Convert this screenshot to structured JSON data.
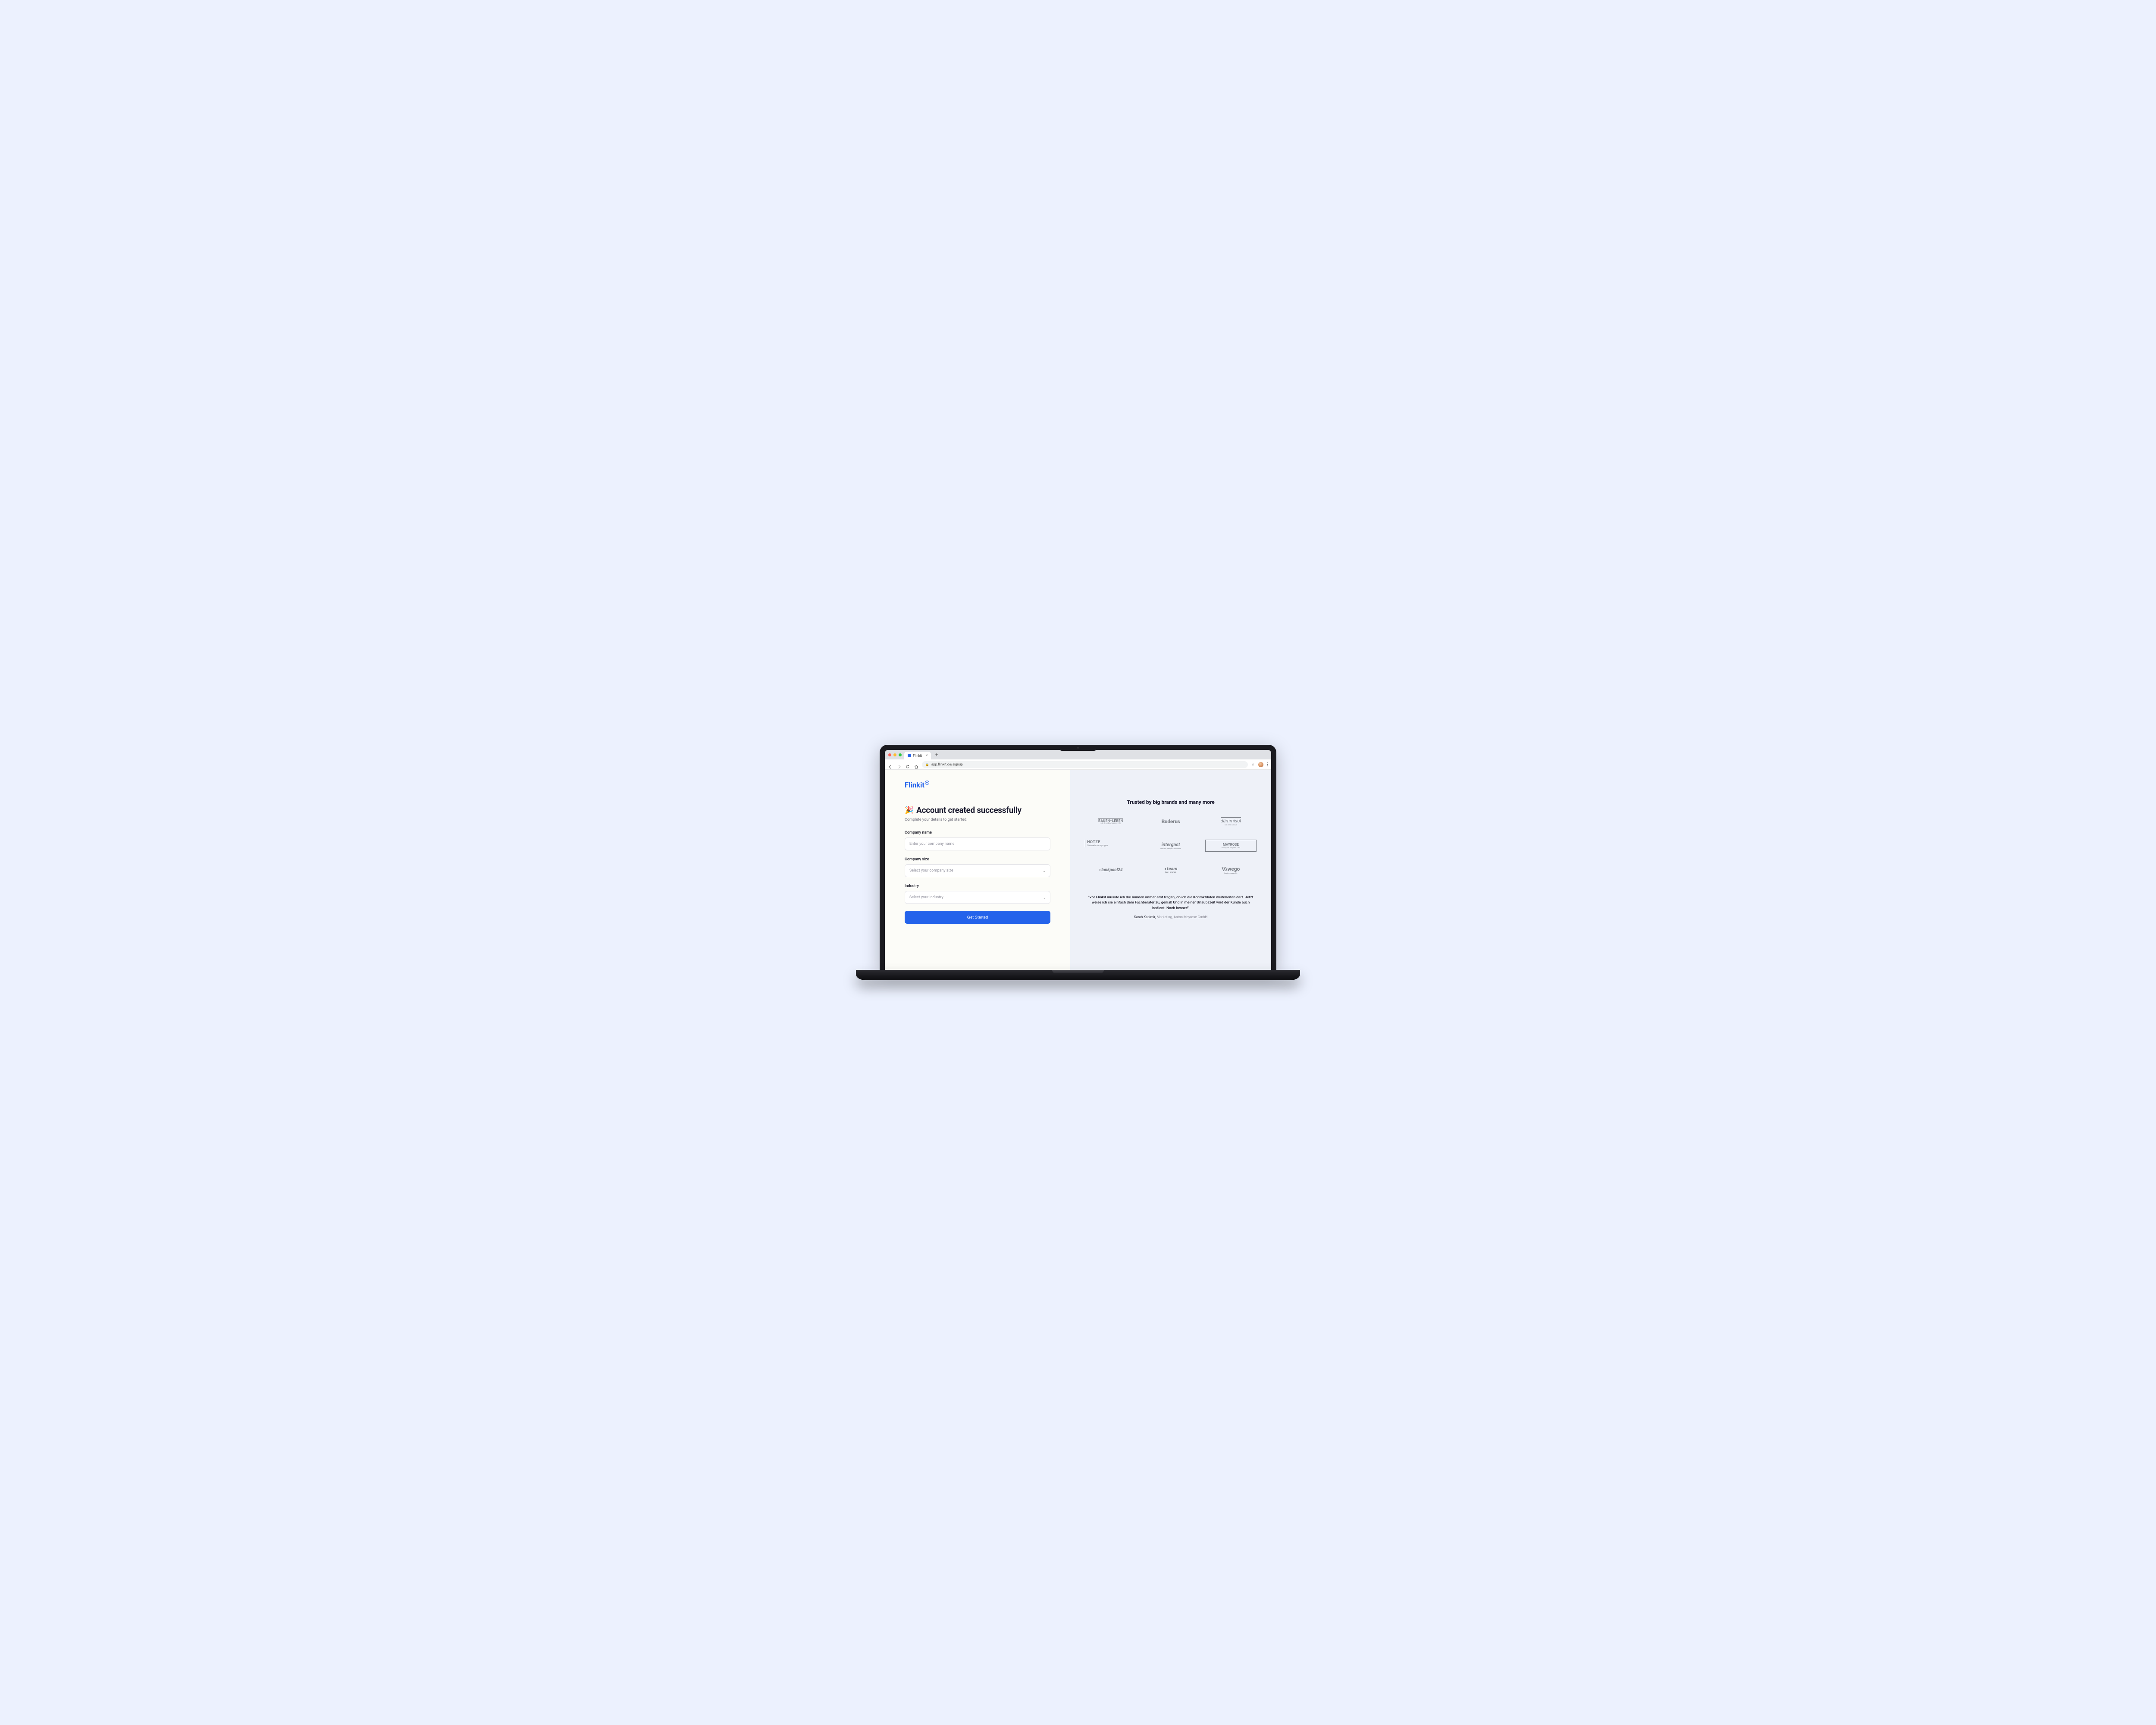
{
  "browser": {
    "tab_title": "Flinkit",
    "url": "app.flinkit.de/signup"
  },
  "logo": {
    "text": "Flinkit"
  },
  "header": {
    "emoji": "🎉",
    "title": "Account created successfully",
    "subtitle": "Complete your details to get started."
  },
  "form": {
    "company_name": {
      "label": "Company name",
      "placeholder": "Enter your company name"
    },
    "company_size": {
      "label": "Company size",
      "placeholder": "Select your company size"
    },
    "industry": {
      "label": "Industry",
      "placeholder": "Select your industry"
    },
    "submit_label": "Get Started"
  },
  "right": {
    "trusted_heading": "Trusted by big brands and many more",
    "logos": {
      "bauenleben": {
        "main": "BAUEN+LEBEN",
        "sub": "IHR BAUFACHHANDEL"
      },
      "buderus": {
        "main": "Buderus"
      },
      "dammisol": {
        "main": "dämmisol",
        "sub": "DIE WAS DRAUS"
      },
      "hotze": {
        "main": "HOTZE",
        "sub": "Unternehmensgruppe"
      },
      "intergast": {
        "main": "intergast",
        "sub": "und den Rezept    Kundennah"
      },
      "mayrose": {
        "main": "MAYROSE",
        "sub": "Hausgaus für jedes Dart"
      },
      "tankpool": {
        "main": "tankpool24"
      },
      "team": {
        "main": "team",
        "sub": "bau · energie"
      },
      "wego": {
        "main": "wego",
        "sub": "Systembaustoffe"
      }
    },
    "testimonial": {
      "quote": "\"Vor Flinkit musste ich die Kunden immer erst fragen, ob ich die Kontaktdaten weiterleiten darf. Jetzt weise ich sie einfach dem Fachberater zu, genial! Und in meiner Urlaubszeit wird der Kunde auch bedient. Noch besser!\"",
      "author_name": "Sarah Kasimir, ",
      "author_role": "Marketing, Anton Mayrose GmbH"
    }
  }
}
